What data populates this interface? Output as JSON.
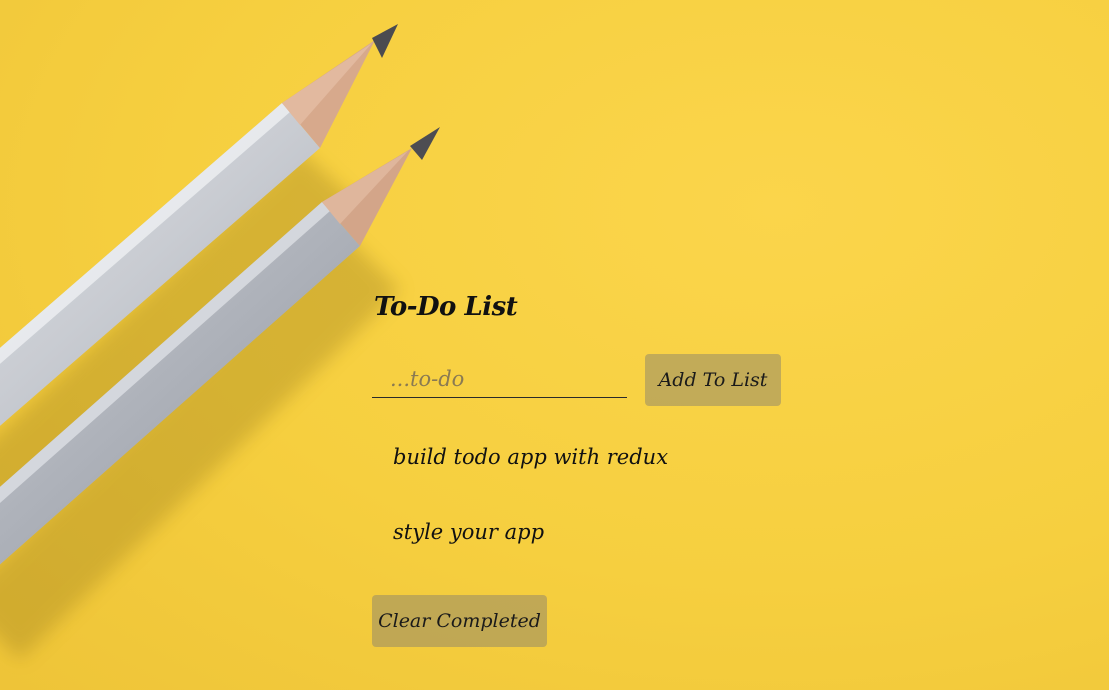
{
  "app": {
    "title": "To-Do List",
    "input": {
      "placeholder": "...to-do",
      "value": ""
    },
    "add_button_label": "Add To List",
    "todos": [
      {
        "text": "build todo app with redux"
      },
      {
        "text": "style your app"
      }
    ],
    "clear_button_label": "Clear Completed"
  },
  "colors": {
    "background": "#f6cf3f",
    "button_bg": "#968a68",
    "text": "#111111"
  }
}
